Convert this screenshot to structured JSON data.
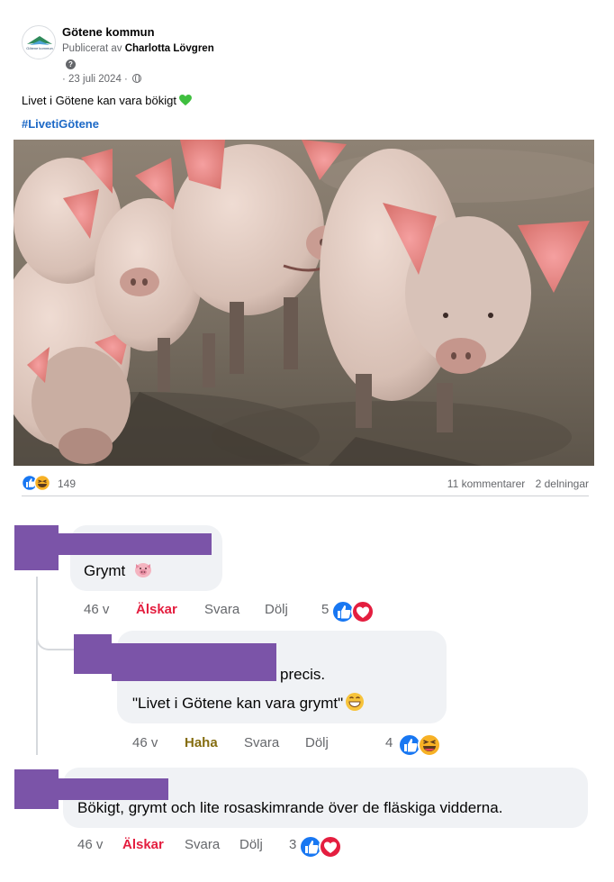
{
  "post": {
    "page_name": "Götene kommun",
    "logo_text": "Götene kommun",
    "published_prefix": "Publicerat av",
    "publisher": "Charlotta Lövgren",
    "help_glyph": "?",
    "date": "· 23 juli 2024 ·",
    "text": "Livet i Götene kan vara bökigt",
    "hashtag": "#LivetiGötene",
    "emoji": "green-heart-icon"
  },
  "reactions": {
    "count": "149",
    "comments": "11 kommentarer",
    "shares": "2 delningar",
    "icons": [
      "like-icon",
      "haha-icon"
    ]
  },
  "comments": [
    {
      "text": "Grymt",
      "emoji": "pig-face-icon",
      "time": "46 v",
      "reaction_label": "Älskar",
      "reply": "Svara",
      "hide": "Dölj",
      "reaction_count": "5",
      "reaction_icons": [
        "like-icon",
        "love-icon"
      ]
    },
    {
      "line1": "precis.",
      "line2": "\"Livet i Götene kan vara grymt\"",
      "emoji": "grinning-face-icon",
      "time": "46 v",
      "reaction_label": "Haha",
      "reply": "Svara",
      "hide": "Dölj",
      "reaction_count": "4",
      "reaction_icons": [
        "like-icon",
        "haha-icon"
      ]
    },
    {
      "text": "Bökigt, grymt och lite rosaskimrande över de fläskiga vidderna.",
      "time": "46 v",
      "reaction_label": "Älskar",
      "reply": "Svara",
      "hide": "Dölj",
      "reaction_count": "3",
      "reaction_icons": [
        "like-icon",
        "love-icon"
      ]
    }
  ],
  "colors": {
    "like_blue": "#1877f2",
    "love_red": "#e41e3f",
    "haha_yellow": "#f7b125",
    "hashtag_blue": "#1b68c6",
    "redaction": "#7b54a8",
    "bubble": "#f0f2f5"
  }
}
